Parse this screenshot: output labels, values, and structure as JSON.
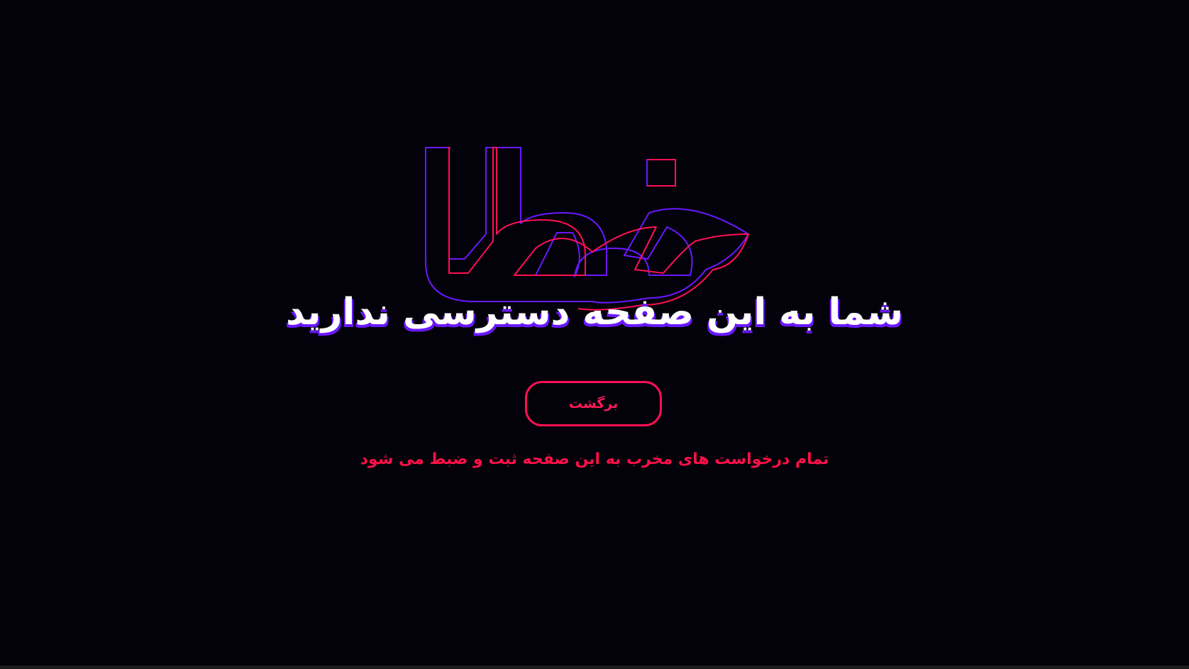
{
  "logo": {
    "text": "خطا",
    "stroke_primary": "#ff0f55",
    "stroke_secondary": "#6b18ff"
  },
  "main": {
    "heading": "شما به این صفحه دسترسی ندارید",
    "back_button_label": "برگشت",
    "warning": "تمام درخواست های مخرب به این صفحه ثبت و ضبط می شود"
  },
  "colors": {
    "background": "#03020a",
    "accent_red": "#ff0f55",
    "accent_purple": "#6b18ff",
    "heading_text": "#ffffff"
  }
}
